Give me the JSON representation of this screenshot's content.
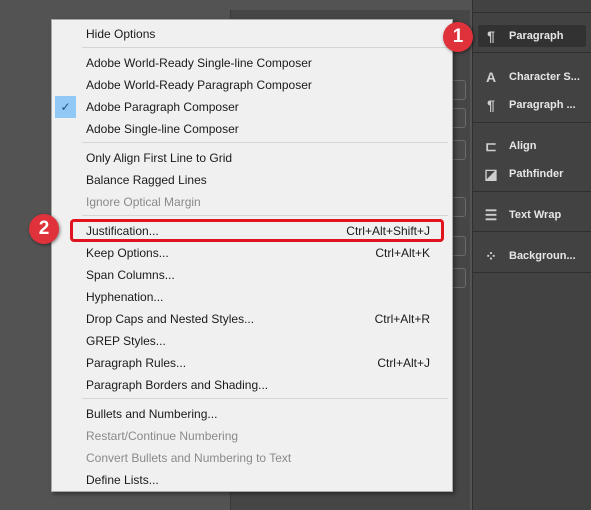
{
  "panel": {
    "items": [
      {
        "label": "Paragraph",
        "icon": "pilcrow-icon",
        "glyph": "¶",
        "active": true
      },
      {
        "label": "Character S...",
        "icon": "character-styles-icon",
        "glyph": "A"
      },
      {
        "label": "Paragraph ...",
        "icon": "paragraph-styles-icon",
        "glyph": "¶"
      },
      {
        "label": "Align",
        "icon": "align-icon",
        "glyph": "⊏"
      },
      {
        "label": "Pathfinder",
        "icon": "pathfinder-icon",
        "glyph": "◪"
      },
      {
        "label": "Text Wrap",
        "icon": "text-wrap-icon",
        "glyph": "☰"
      },
      {
        "label": "Backgroun...",
        "icon": "background-tasks-icon",
        "glyph": "⁘"
      }
    ]
  },
  "menu": {
    "items": [
      {
        "label": "Hide Options",
        "shortcut": ""
      },
      {
        "label": "Adobe World-Ready Single-line Composer",
        "shortcut": ""
      },
      {
        "label": "Adobe World-Ready Paragraph Composer",
        "shortcut": ""
      },
      {
        "label": "Adobe Paragraph Composer",
        "shortcut": "",
        "checked": true
      },
      {
        "label": "Adobe Single-line Composer",
        "shortcut": ""
      },
      {
        "label": "Only Align First Line to Grid",
        "shortcut": ""
      },
      {
        "label": "Balance Ragged Lines",
        "shortcut": ""
      },
      {
        "label": "Ignore Optical Margin",
        "shortcut": "",
        "disabled": true
      },
      {
        "label": "Justification...",
        "shortcut": "Ctrl+Alt+Shift+J",
        "highlighted": true
      },
      {
        "label": "Keep Options...",
        "shortcut": "Ctrl+Alt+K"
      },
      {
        "label": "Span Columns...",
        "shortcut": ""
      },
      {
        "label": "Hyphenation...",
        "shortcut": ""
      },
      {
        "label": "Drop Caps and Nested Styles...",
        "shortcut": "Ctrl+Alt+R"
      },
      {
        "label": "GREP Styles...",
        "shortcut": ""
      },
      {
        "label": "Paragraph Rules...",
        "shortcut": "Ctrl+Alt+J"
      },
      {
        "label": "Paragraph Borders and Shading...",
        "shortcut": ""
      },
      {
        "label": "Bullets and Numbering...",
        "shortcut": ""
      },
      {
        "label": "Restart/Continue Numbering",
        "shortcut": "",
        "disabled": true
      },
      {
        "label": "Convert Bullets and Numbering to Text",
        "shortcut": "",
        "disabled": true
      },
      {
        "label": "Define Lists...",
        "shortcut": ""
      }
    ]
  },
  "badges": {
    "one": "1",
    "two": "2"
  },
  "colors": {
    "highlight": "#e0141e",
    "badge": "#e0323a",
    "check_bg": "#90c8f6"
  }
}
